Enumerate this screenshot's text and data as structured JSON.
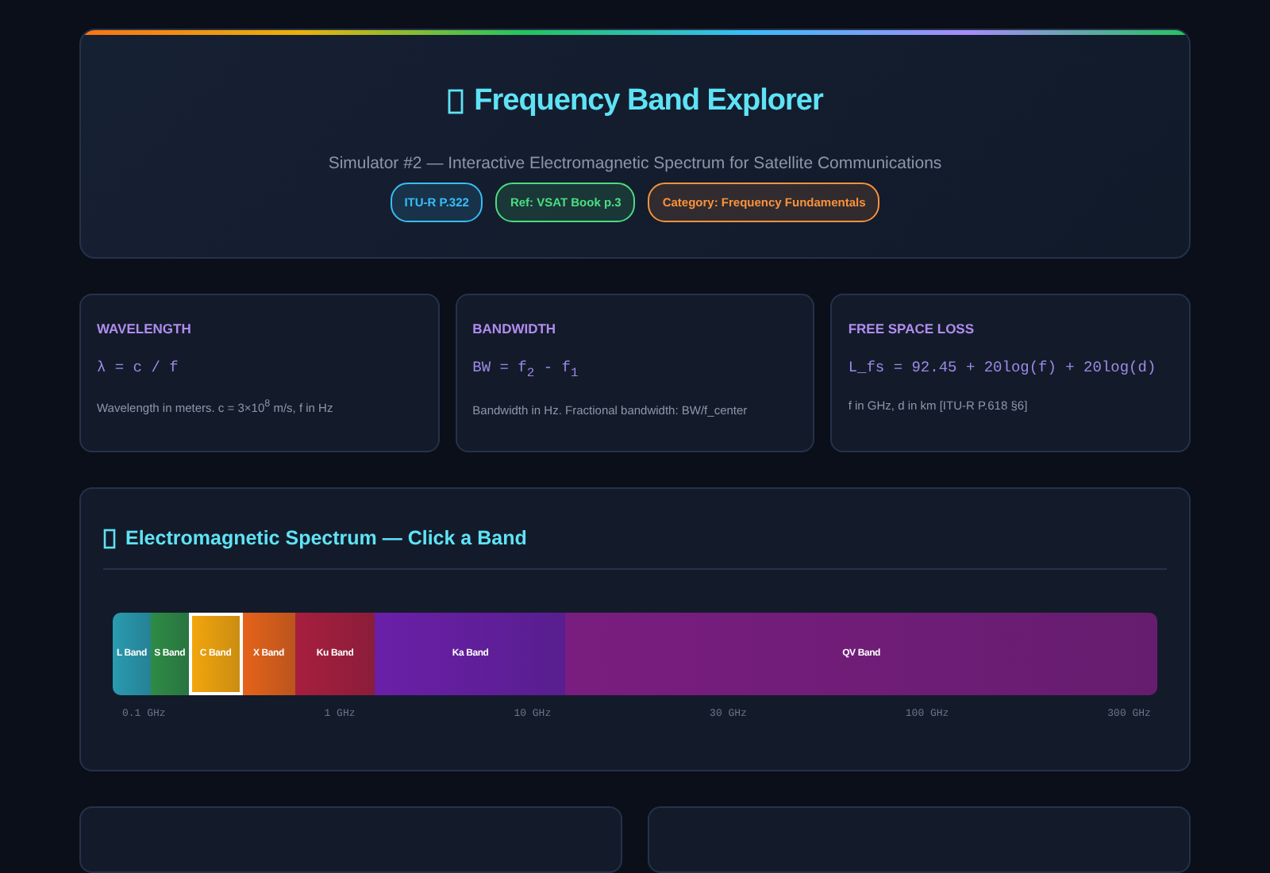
{
  "header": {
    "title": "Frequency Band Explorer",
    "subtitle": "Simulator #2 — Interactive Electromagnetic Spectrum for Satellite Communications",
    "badges": [
      {
        "label": "ITU-R P.322",
        "color": "#38bdf8"
      },
      {
        "label": "Ref: VSAT Book p.3",
        "color": "#4ade80"
      },
      {
        "label": "Category: Frequency Fundamentals",
        "color": "#fb923c"
      }
    ]
  },
  "formula_cards": [
    {
      "title": "WAVELENGTH",
      "formula": "λ = c / f",
      "note": "Wavelength in meters. c = 3×10$^{8}$ m/s, f in Hz"
    },
    {
      "title": "BANDWIDTH",
      "formula": "BW = f$_{2}$ - f$_{1}$",
      "note": "Bandwidth in Hz. Fractional bandwidth: BW/f_center"
    },
    {
      "title": "FREE SPACE LOSS",
      "formula": "L_fs = 92.45 + 20log(f) + 20log(d)",
      "note": "f in GHz, d in km [ITU-R P.618 §6]"
    }
  ],
  "spectrum": {
    "title": "Electromagnetic Spectrum — Click a Band",
    "bands": [
      {
        "label": "L Band",
        "color": "#2a9bb0",
        "selected": false
      },
      {
        "label": "S Band",
        "color": "#2e8b45",
        "selected": false
      },
      {
        "label": "C Band",
        "color": "#f5a70c",
        "selected": true
      },
      {
        "label": "X Band",
        "color": "#e5631a",
        "selected": false
      },
      {
        "label": "Ku Band",
        "color": "#a81e3e",
        "selected": false
      },
      {
        "label": "Ka Band",
        "color": "#6a1fa8",
        "selected": false
      },
      {
        "label": "QV Band",
        "color": "#7a1d80",
        "selected": false
      }
    ],
    "ticks": [
      "0.1 GHz",
      "1 GHz",
      "10 GHz",
      "30 GHz",
      "100 GHz",
      "300 GHz"
    ]
  }
}
